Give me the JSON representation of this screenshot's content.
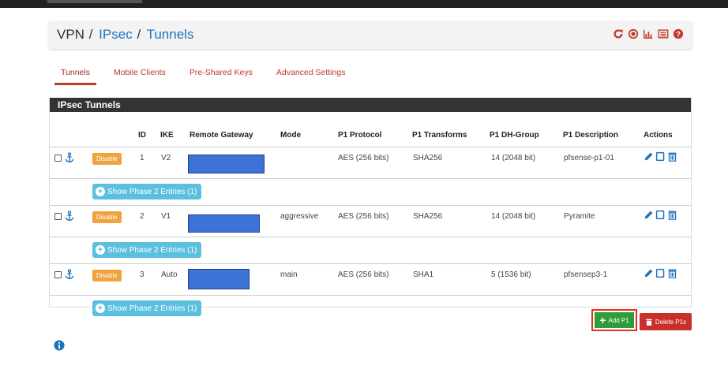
{
  "breadcrumb": {
    "root": "VPN",
    "sep": "/",
    "level1": "IPsec",
    "current": "Tunnels"
  },
  "header_icons": [
    "reload-icon",
    "record-icon",
    "chart-icon",
    "list-icon",
    "help-icon"
  ],
  "tabs": [
    {
      "label": "Tunnels",
      "active": true
    },
    {
      "label": "Mobile Clients",
      "active": false
    },
    {
      "label": "Pre-Shared Keys",
      "active": false
    },
    {
      "label": "Advanced Settings",
      "active": false
    }
  ],
  "panel": {
    "title": "IPsec Tunnels",
    "columns": [
      "ID",
      "IKE",
      "Remote Gateway",
      "Mode",
      "P1 Protocol",
      "P1 Transforms",
      "P1 DH-Group",
      "P1 Description",
      "Actions"
    ]
  },
  "tunnels": [
    {
      "disable_label": "Disable",
      "id": "1",
      "ike": "V2",
      "mode": "",
      "protocol": "AES (256 bits)",
      "transforms": "SHA256",
      "dh_group": "14 (2048 bit)",
      "description": "pfsense-p1-01",
      "phase2_label": "Show Phase 2 Entries (1)"
    },
    {
      "disable_label": "Disable",
      "id": "2",
      "ike": "V1",
      "mode": "aggressive",
      "protocol": "AES (256 bits)",
      "transforms": "SHA256",
      "dh_group": "14 (2048 bit)",
      "description": "Pyramite",
      "phase2_label": "Show Phase 2 Entries (1)"
    },
    {
      "disable_label": "Disable",
      "id": "3",
      "ike": "Auto",
      "mode": "main",
      "protocol": "AES (256 bits)",
      "transforms": "SHA1",
      "dh_group": "5 (1536 bit)",
      "description": "pfsensep3-1",
      "phase2_label": "Show Phase 2 Entries (1)"
    }
  ],
  "buttons": {
    "add_label": "Add P1",
    "delete_label": "Delete P1s"
  },
  "colors": {
    "accent_red": "#c0392b",
    "disable_orange": "#f0a33c",
    "phase2_blue": "#5bc0de",
    "add_green": "#2f9e3a",
    "delete_red": "#c9302c",
    "redacted_blue": "#3d72d6"
  }
}
